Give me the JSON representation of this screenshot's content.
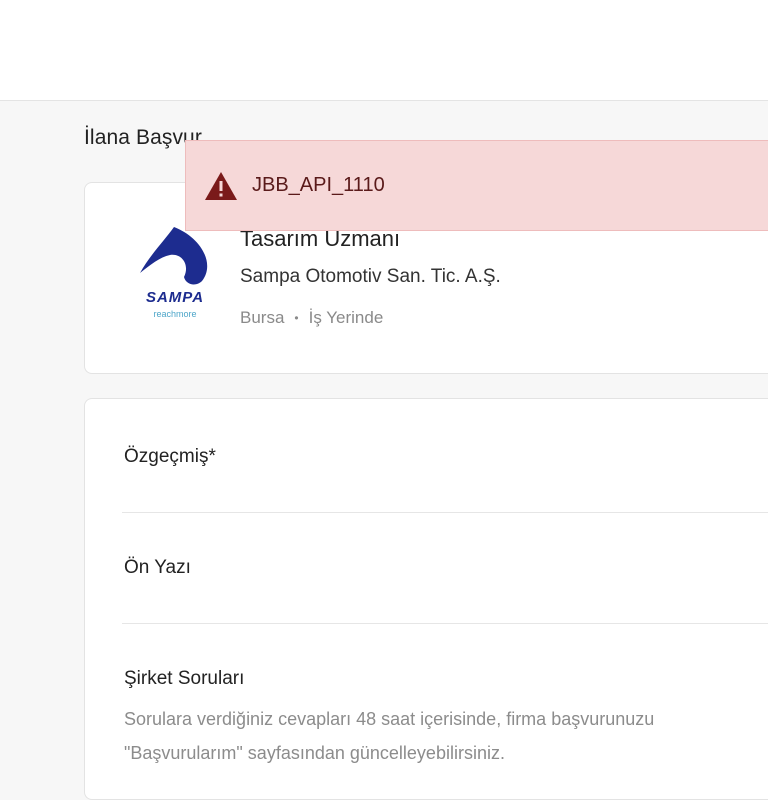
{
  "page": {
    "title": "İlana Başvur"
  },
  "job": {
    "title": "Tasarım Uzmanı",
    "company": "Sampa Otomotiv San. Tic. A.Ş.",
    "location": "Bursa",
    "work_type": "İş Yerinde",
    "logo": {
      "wordmark": "SAMPA",
      "tagline": "reachmore",
      "icon": "sampa-logo"
    }
  },
  "form": {
    "resume_label": "Özgeçmiş*",
    "cover_letter_label": "Ön Yazı",
    "company_questions_label": "Şirket Soruları",
    "company_questions_desc_line1": "Sorulara verdiğiniz cevapları 48 saat içerisinde, firma başvurunuzu",
    "company_questions_desc_line2": "\"Başvurularım\" sayfasından güncelleyebilirsiniz."
  },
  "toast": {
    "message": "JBB_API_1110",
    "icon": "warning-icon",
    "color": "#f6d8d8",
    "icon_color": "#7a1a1a"
  }
}
